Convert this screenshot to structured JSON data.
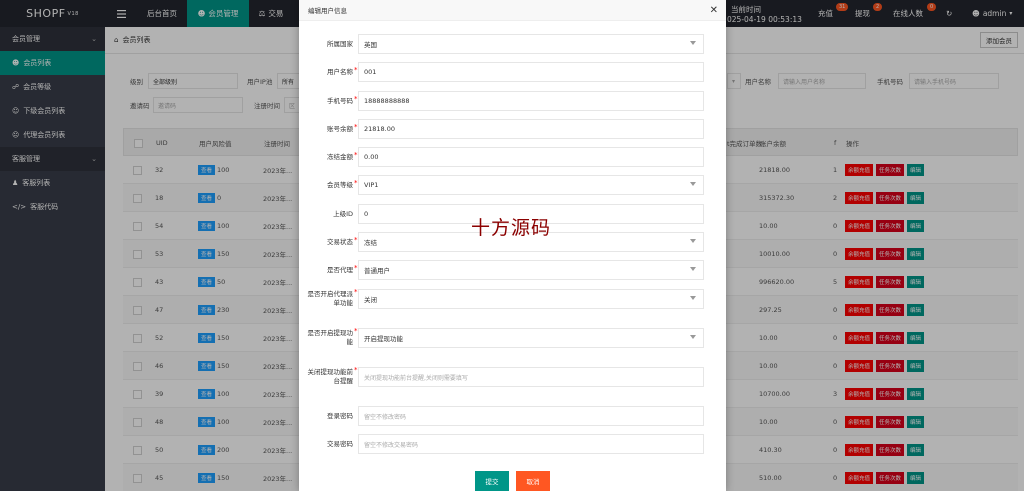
{
  "topbar": {
    "logo": "SHOPF",
    "logo_version": "V18",
    "menu_icon": "menu-icon",
    "nav": [
      "后台首页",
      "会员管理",
      "交易"
    ],
    "current_time_label": "当前时间",
    "current_time_value": "025-04-19 00:53:13",
    "recharge_label": "充值",
    "recharge_count": "31",
    "withdraw_label": "提现",
    "withdraw_count": "2",
    "online_label": "在线人数",
    "online_count": "0",
    "refresh_icon": "refresh-icon",
    "user": "admin"
  },
  "sidebar": {
    "groups": [
      {
        "label": "会员管理",
        "items": [
          "会员列表",
          "会员等级",
          "下级会员列表",
          "代理会员列表"
        ]
      },
      {
        "label": "客服管理",
        "items": [
          "客服列表",
          "客服代码"
        ]
      }
    ]
  },
  "main": {
    "breadcrumb": "会员列表",
    "add_button": "添加会员",
    "filters": {
      "level_label": "级别",
      "level_value": "全部级别",
      "ip_label": "用户IP池",
      "ip_value": "所有",
      "invite_label": "邀请码",
      "invite_placeholder": "邀请码",
      "reg_time_label": "注册时间",
      "reg_time_placeholder": "区",
      "username_label": "用户名称",
      "username_placeholder": "请输入用户名称",
      "phone_label": "手机号码",
      "phone_placeholder": "请输入手机号码"
    },
    "table": {
      "headers": [
        "UID",
        "用户风险值",
        "注册时间",
        "t完成订单数",
        "账户余额",
        "f",
        "操作"
      ],
      "view_label": "查看",
      "actions": [
        "余额充值",
        "任务次数",
        "编辑"
      ],
      "rows": [
        {
          "uid": "32",
          "risk": "100",
          "time": "2023年...",
          "balance": "21818.00",
          "f": "1"
        },
        {
          "uid": "18",
          "risk": "0",
          "time": "2023年...",
          "balance": "315372.30",
          "f": "2"
        },
        {
          "uid": "54",
          "risk": "100",
          "time": "2023年...",
          "balance": "10.00",
          "f": "0"
        },
        {
          "uid": "53",
          "risk": "150",
          "time": "2023年...",
          "balance": "10010.00",
          "f": "0"
        },
        {
          "uid": "43",
          "risk": "50",
          "time": "2023年...",
          "balance": "996620.00",
          "f": "5"
        },
        {
          "uid": "47",
          "risk": "230",
          "time": "2023年...",
          "balance": "297.25",
          "f": "0"
        },
        {
          "uid": "52",
          "risk": "150",
          "time": "2023年...",
          "balance": "10.00",
          "f": "0"
        },
        {
          "uid": "46",
          "risk": "150",
          "time": "2023年...",
          "balance": "10.00",
          "f": "0"
        },
        {
          "uid": "39",
          "risk": "100",
          "time": "2023年...",
          "balance": "10700.00",
          "f": "3"
        },
        {
          "uid": "48",
          "risk": "100",
          "time": "2023年...",
          "balance": "10.00",
          "f": "0"
        },
        {
          "uid": "50",
          "risk": "200",
          "time": "2023年...",
          "balance": "410.30",
          "f": "0"
        },
        {
          "uid": "45",
          "risk": "150",
          "time": "2023年...",
          "balance": "510.00",
          "f": "0"
        }
      ]
    }
  },
  "modal": {
    "title": "编辑用户信息",
    "close_icon": "close-icon",
    "fields": [
      {
        "label": "所属国家",
        "value": "英国",
        "type": "select",
        "required": false
      },
      {
        "label": "用户名称",
        "value": "001",
        "type": "text",
        "required": true
      },
      {
        "label": "手机号码",
        "value": "18888888888",
        "type": "text",
        "required": true
      },
      {
        "label": "账号余额",
        "value": "21818.00",
        "type": "text",
        "required": true
      },
      {
        "label": "冻结金额",
        "value": "0.00",
        "type": "text",
        "required": true
      },
      {
        "label": "会员等级",
        "value": "VIP1",
        "type": "select",
        "required": true
      },
      {
        "label": "上级ID",
        "value": "0",
        "type": "text",
        "required": false
      },
      {
        "label": "交易状态",
        "value": "冻结",
        "type": "select",
        "required": true
      },
      {
        "label": "是否代理",
        "value": "普通用户",
        "type": "select",
        "required": true
      },
      {
        "label": "是否开启代理派单功能",
        "value": "关闭",
        "type": "select",
        "required": true
      },
      {
        "label": "是否开启提现功能",
        "value": "开启提现功能",
        "type": "select",
        "required": true
      },
      {
        "label": "关闭提现功能前台提醒",
        "value": "",
        "placeholder": "关闭提现功能前台提醒,关闭则需要填写",
        "type": "text",
        "required": true
      },
      {
        "label": "登录密码",
        "value": "",
        "placeholder": "留空不修改密码",
        "type": "text",
        "required": false
      },
      {
        "label": "交易密码",
        "value": "",
        "placeholder": "留空不修改交易密码",
        "type": "text",
        "required": false
      }
    ],
    "watermark": "十方源码",
    "submit": "提交",
    "cancel": "取消"
  },
  "colors": {
    "accent": "#009688",
    "topbar": "#23262e",
    "sidebar": "#393d49",
    "danger": "#ff0000",
    "cancel": "#ff5722",
    "info": "#1e9fff"
  }
}
